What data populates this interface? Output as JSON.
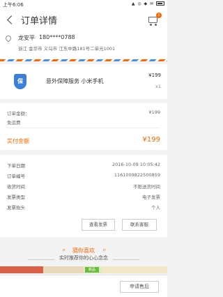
{
  "status_bar": {
    "time": "上午6:06",
    "icons": "▲ ◎ ◆ ✉"
  },
  "header": {
    "title": "订单详情",
    "cart_badge": "1"
  },
  "address": {
    "name": "龙安平",
    "phone": "180****0788",
    "line": "浙江  金华市  义乌市    江东中路181号二单元1001"
  },
  "product": {
    "icon_text": "保",
    "name": "意外保障服务 小米手机",
    "price": "¥199",
    "quantity": "x1"
  },
  "summary": {
    "order_amount_label": "订单金额：",
    "order_amount_value": "¥199",
    "shipping_label": "免运费",
    "actual_label": "实付金额",
    "actual_value": "¥199"
  },
  "details": {
    "rows": [
      {
        "label": "下单日期",
        "value": "2016-10-09 10:05:42"
      },
      {
        "label": "订单编号",
        "value": "1161009822500859"
      },
      {
        "label": "收货时间",
        "value": "不限送货时间"
      },
      {
        "label": "发票类型",
        "value": "电子发票"
      },
      {
        "label": "发票抬头",
        "value": "个人"
      }
    ],
    "view_invoice": "查看发票",
    "contact_service": "联系客服"
  },
  "recommend": {
    "title": "猜你喜欢",
    "subtitle": "实时推荐你的心心念念"
  },
  "promo": {
    "new_tag": "新品"
  },
  "footer": {
    "apply_after_sale": "申请售后"
  },
  "colors": {
    "accent": "#ff6700",
    "shield": "#3d7fd8",
    "new_tag": "#6dbb3a"
  }
}
